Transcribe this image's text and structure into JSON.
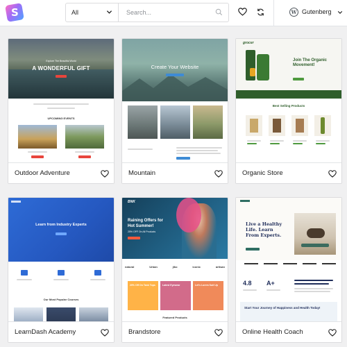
{
  "header": {
    "logo_letter": "S",
    "category": {
      "selected": "All"
    },
    "search": {
      "placeholder": "Search..."
    },
    "builder": {
      "selected": "Gutenberg"
    },
    "icons": [
      "search-icon",
      "heart-icon",
      "refresh-icon",
      "wordpress-icon",
      "chevron-down-icon"
    ]
  },
  "templates": [
    {
      "name": "Outdoor Adventure",
      "preview": {
        "hero_kicker": "Explore The Beautiful World",
        "hero_title": "A WONDERFUL GIFT",
        "section_title": "UPCOMING EVENTS"
      }
    },
    {
      "name": "Mountain",
      "preview": {
        "hero_title": "Create Your Website"
      }
    },
    {
      "name": "Organic Store",
      "preview": {
        "logo": "grocer",
        "hero_title": "Join The Organic Movement!",
        "section_title": "Best Selling Products"
      }
    },
    {
      "name": "LearnDash Academy",
      "preview": {
        "hero_title": "Learn from Industry Experts",
        "section_title": "Our Most Popular Courses"
      }
    },
    {
      "name": "Brandstore",
      "preview": {
        "logo": "BNK",
        "hero_title": "Raining Offers for Hot Summer!",
        "hero_sub": "25% OFF On All Products",
        "brands": [
          "natural",
          "Urban",
          "jiko",
          "iconic",
          "artisan"
        ],
        "promo_1": "20% Off On Tank Tops",
        "promo_2": "Latest Eyewear",
        "promo_3": "Let's Lorem Suit Up",
        "section_title": "Featured Products"
      }
    },
    {
      "name": "Online Health Coach",
      "preview": {
        "hero_title": "Live a Healthy Life. Learn From Experts.",
        "stat_1": "4.8",
        "stat_2": "A+",
        "cta": "Start Your Journey of Happiness and Health Today!"
      }
    }
  ],
  "colors": {
    "page_bg": "#f0f0f1",
    "card_border": "#dcdcde",
    "learndash_blue": "#2e6bd6",
    "organic_green": "#2f5e2b",
    "health_navy": "#1f2d5a",
    "health_accent": "#2f6e63"
  }
}
